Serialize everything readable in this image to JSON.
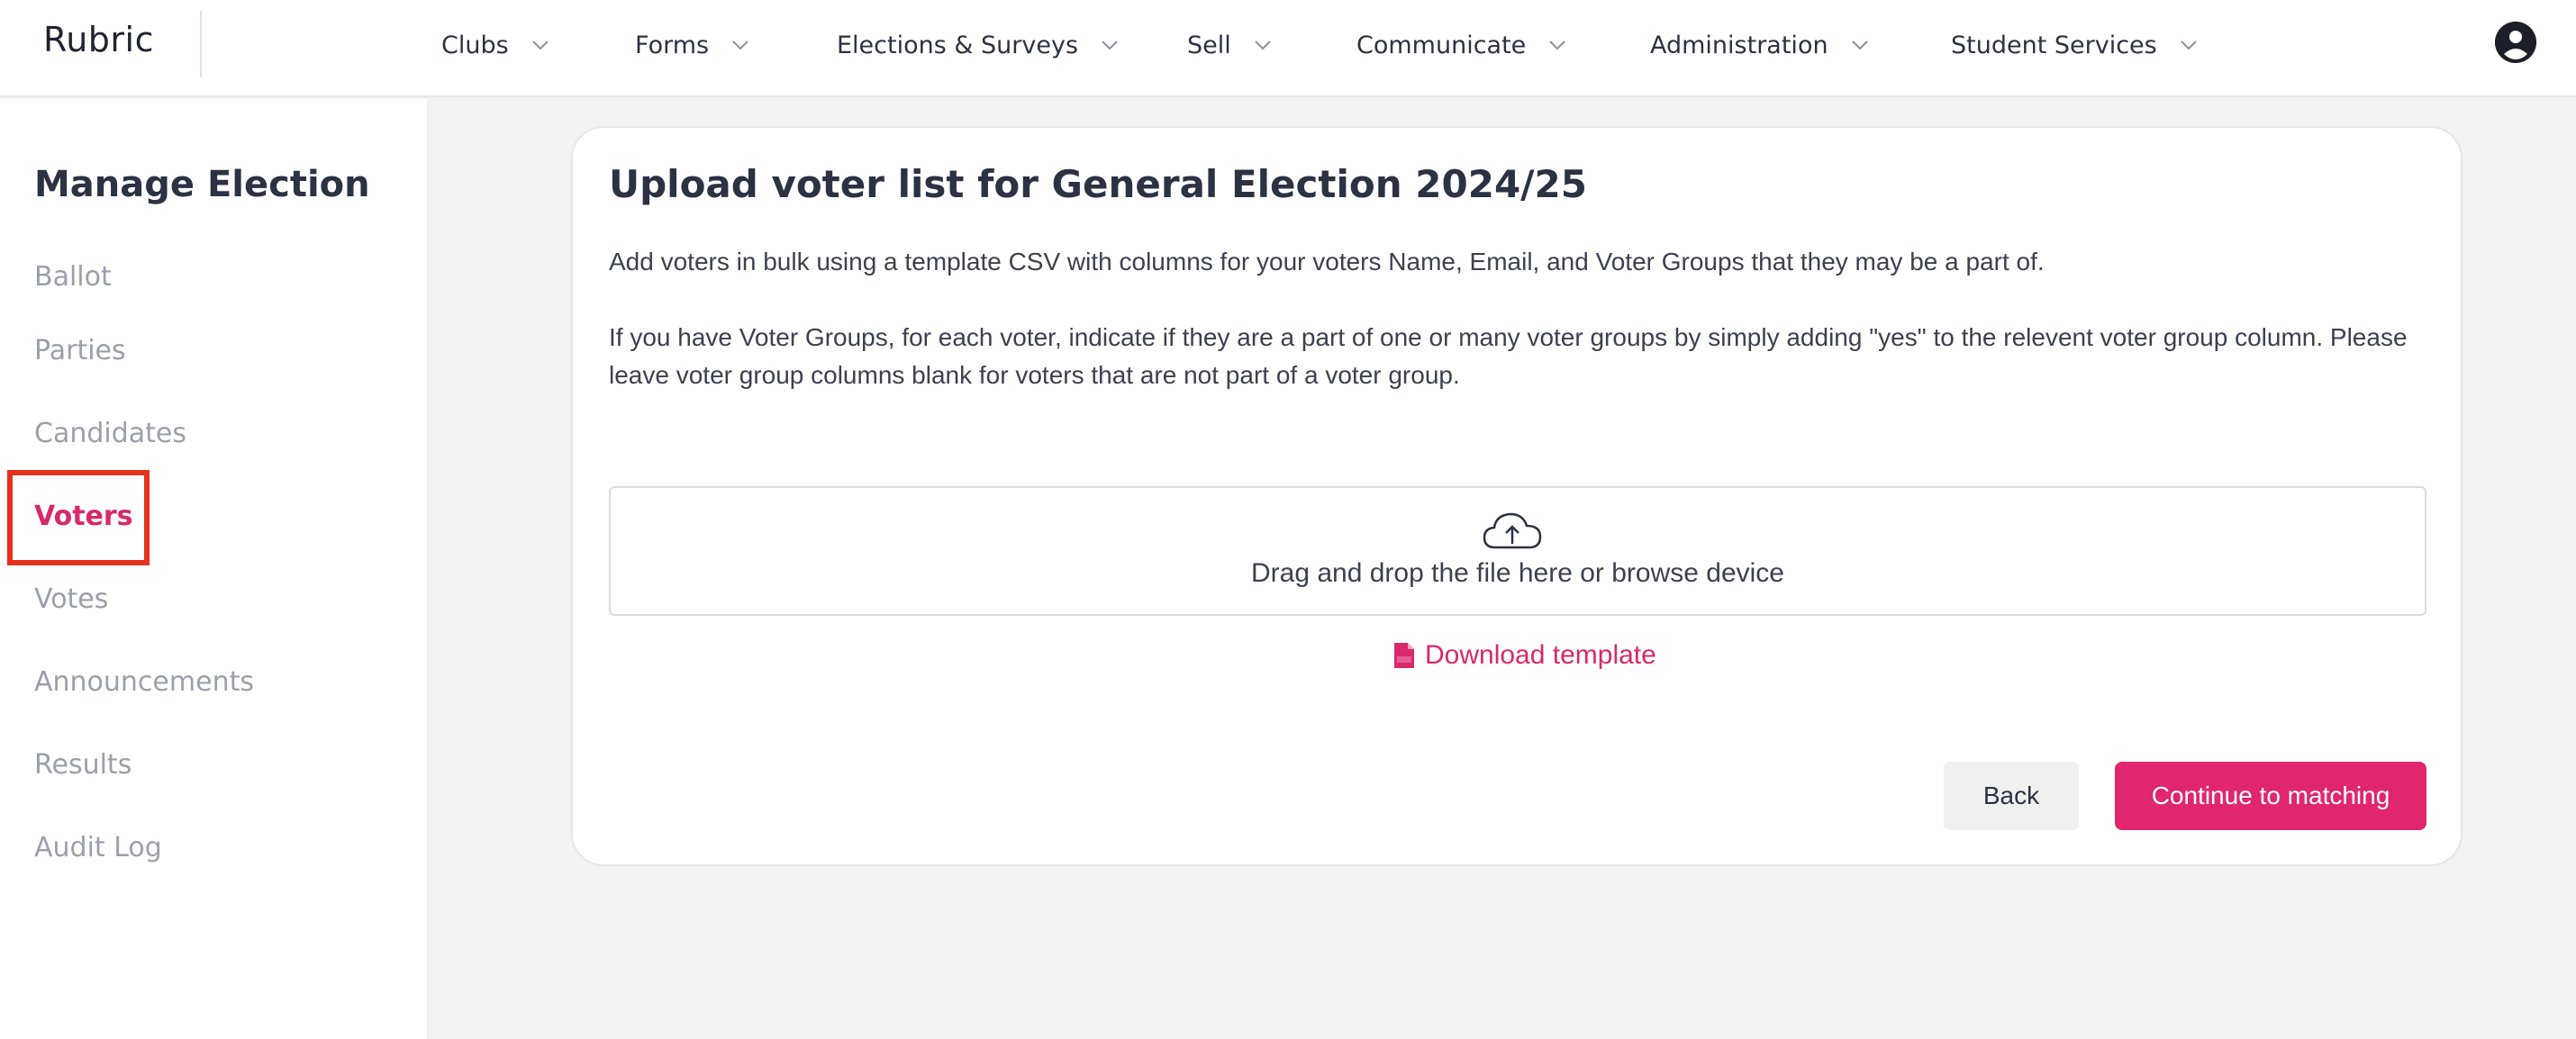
{
  "app": {
    "logo": "Rubric"
  },
  "nav": {
    "items": [
      {
        "label": "Clubs"
      },
      {
        "label": "Forms"
      },
      {
        "label": "Elections & Surveys"
      },
      {
        "label": "Sell"
      },
      {
        "label": "Communicate"
      },
      {
        "label": "Administration"
      },
      {
        "label": "Student Services"
      }
    ],
    "avatar_icon": "user-circle-icon"
  },
  "sidebar": {
    "title": "Manage Election",
    "items": [
      {
        "label": "Ballot",
        "active": false
      },
      {
        "label": "Parties",
        "active": false
      },
      {
        "label": "Candidates",
        "active": false
      },
      {
        "label": "Voters",
        "active": true
      },
      {
        "label": "Votes",
        "active": false
      },
      {
        "label": "Announcements",
        "active": false
      },
      {
        "label": "Results",
        "active": false
      },
      {
        "label": "Audit Log",
        "active": false
      }
    ]
  },
  "main": {
    "title": "Upload voter list for General Election 2024/25",
    "paragraph1": "Add voters in bulk using a template CSV with columns for your voters Name, Email, and Voter Groups that they may be a part of.",
    "paragraph2": "If you have Voter Groups, for each voter, indicate if they are a part of one or many voter groups by simply adding \"yes\" to the relevent voter group column. Please leave voter group columns blank for voters that are not part of a voter group.",
    "dropzone": {
      "icon": "cloud-upload-icon",
      "text": "Drag and drop the file here or browse device"
    },
    "download": {
      "icon": "csv-file-icon",
      "label": "Download template"
    },
    "buttons": {
      "back": "Back",
      "continue": "Continue to matching"
    }
  },
  "colors": {
    "accent": "#e0266f",
    "active_nav": "#d9286c",
    "highlight": "#e6311f",
    "text": "#2b3244",
    "muted": "#9aa0ab",
    "background": "#f2f2f2"
  }
}
